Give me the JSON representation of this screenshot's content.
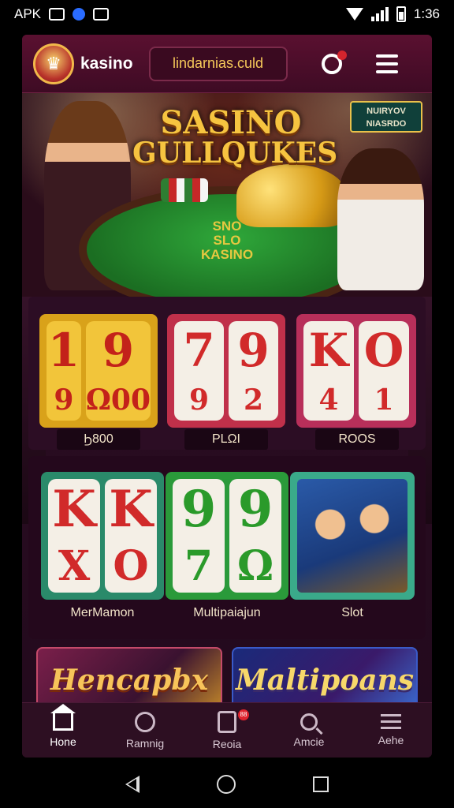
{
  "status_bar": {
    "left_text": "APK",
    "time": "1:36"
  },
  "header": {
    "brand": "kasino",
    "url": "lindarnias.culd"
  },
  "hero": {
    "title_line1": "SASINO",
    "title_line2": "GULLQUKES",
    "badge_line1": "NUIRYOV",
    "badge_line2": "NIASRDO",
    "table_line1": "SNO",
    "table_line2": "SLO",
    "table_line3": "KASINO"
  },
  "row1": [
    {
      "reels": [
        [
          "1",
          "9"
        ],
        [
          "9",
          "Ω00"
        ]
      ],
      "label": "Ϧ800",
      "colors": {
        "frame": "#d9a21a",
        "reel": "#f2c53a",
        "text": "#c3221a"
      }
    },
    {
      "reels": [
        [
          "7",
          "9"
        ],
        [
          "9",
          "2"
        ]
      ],
      "label": "PLΩI",
      "colors": {
        "frame": "#c0304a",
        "reel": "#f4efe6",
        "text": "#d12a2a"
      }
    },
    {
      "reels": [
        [
          "K",
          "4"
        ],
        [
          "O",
          "1"
        ]
      ],
      "label": "ROOS",
      "colors": {
        "frame": "#b82f5a",
        "reel": "#f4efe6",
        "text": "#d12a2a"
      }
    }
  ],
  "row2": [
    {
      "reels": [
        [
          "K",
          "X"
        ],
        [
          "K",
          "O"
        ]
      ],
      "label": "MerMamon",
      "colors": {
        "frame": "#2a8a6a",
        "reel": "#f4efe6",
        "text": "#d12a2a"
      }
    },
    {
      "reels": [
        [
          "9",
          "7"
        ],
        [
          "9",
          "Ω"
        ]
      ],
      "label": "Multipaiajun",
      "colors": {
        "frame": "#2a9a3a",
        "reel": "#f4efe6",
        "text": "#2a9a2a"
      }
    },
    {
      "label": "Slot",
      "colors": {
        "frame": "#3aaa8a"
      }
    }
  ],
  "banners": [
    {
      "text": "Hencapbx"
    },
    {
      "text": "Maltipoans"
    }
  ],
  "nav": [
    {
      "label": "Hone",
      "icon": "home-icon",
      "active": true
    },
    {
      "label": "Ramnig",
      "icon": "clock-icon"
    },
    {
      "label": "Reoia",
      "icon": "document-icon",
      "badge": "88"
    },
    {
      "label": "Amcie",
      "icon": "search-icon"
    },
    {
      "label": "Aehe",
      "icon": "menu-icon"
    }
  ]
}
